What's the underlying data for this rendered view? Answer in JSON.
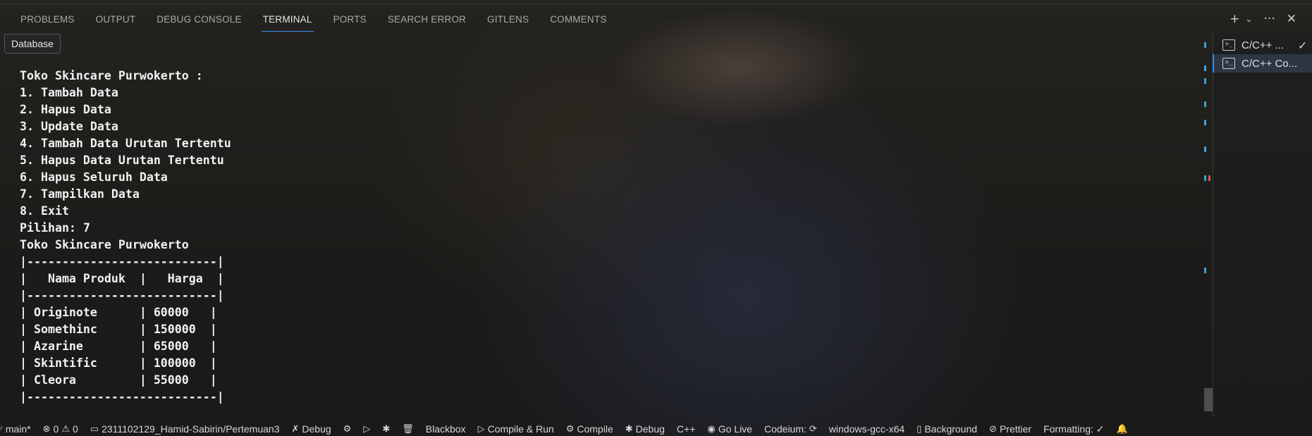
{
  "panel": {
    "tabs": [
      {
        "label": "PROBLEMS"
      },
      {
        "label": "OUTPUT"
      },
      {
        "label": "DEBUG CONSOLE"
      },
      {
        "label": "TERMINAL",
        "active": true
      },
      {
        "label": "PORTS"
      },
      {
        "label": "SEARCH ERROR"
      },
      {
        "label": "GITLENS"
      },
      {
        "label": "COMMENTS"
      }
    ],
    "actions": {
      "new_terminal": "+",
      "dropdown": "⌄",
      "more": "···",
      "close": "✕"
    },
    "tooltip": "Database"
  },
  "terminal": {
    "lines": [
      "Toko Skincare Purwokerto :",
      "1. Tambah Data",
      "2. Hapus Data",
      "3. Update Data",
      "4. Tambah Data Urutan Tertentu",
      "5. Hapus Data Urutan Tertentu",
      "6. Hapus Seluruh Data",
      "7. Tampilkan Data",
      "8. Exit",
      "Pilihan: 7",
      "Toko Skincare Purwokerto",
      "|---------------------------|",
      "|   Nama Produk  |   Harga  |",
      "|---------------------------|",
      "| Originote      | 60000   |",
      "| Somethinc      | 150000  |",
      "| Azarine        | 65000   |",
      "| Skintific      | 100000  |",
      "| Cleora         | 55000   |",
      "|---------------------------|"
    ],
    "products": [
      {
        "name": "Originote",
        "price": "60000"
      },
      {
        "name": "Somethinc",
        "price": "150000"
      },
      {
        "name": "Azarine",
        "price": "65000"
      },
      {
        "name": "Skintific",
        "price": "100000"
      },
      {
        "name": "Cleora",
        "price": "55000"
      }
    ]
  },
  "terminal_list": [
    {
      "label": "C/C++ ...",
      "icon": "terminal-icon",
      "status_icon": "check-icon",
      "selected": false
    },
    {
      "label": "C/C++ Co...",
      "icon": "terminal-icon",
      "selected": true
    }
  ],
  "status_bar": {
    "branch": "main*",
    "errors": "0",
    "warnings": "0",
    "folder": "2311102129_Hamid-Sabirin/Pertemuan3",
    "debug": "Debug",
    "blackbox": "Blackbox",
    "compile_run": "Compile & Run",
    "compile": "Compile",
    "debug2": "Debug",
    "language": "C++",
    "go_live": "Go Live",
    "codeium": "Codeium:",
    "compiler": "windows-gcc-x64",
    "background": "Background",
    "prettier": "Prettier",
    "formatting": "Formatting: ✓"
  },
  "colors": {
    "accent": "#3b8eea",
    "terminal_text": "#f2f2f2",
    "ruler_marker": "#3ba3d8",
    "ruler_error": "#e05252"
  }
}
